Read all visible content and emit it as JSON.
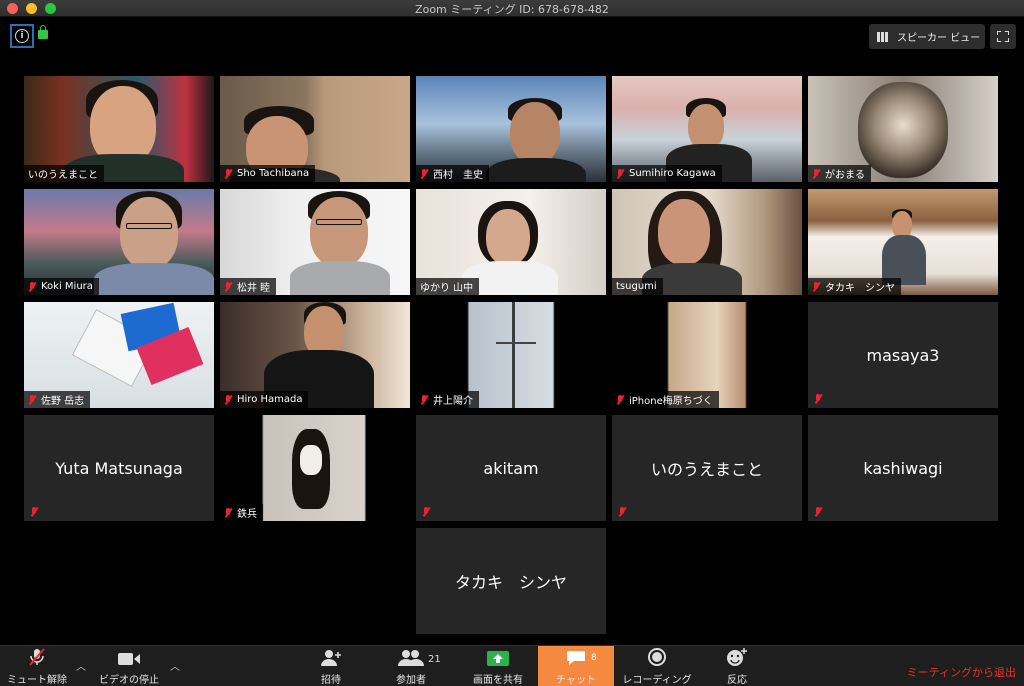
{
  "window": {
    "title": "Zoom ミーティング ID: 678-678-482"
  },
  "topbar": {
    "view_label": "スピーカー ビュー",
    "info_glyph": "i"
  },
  "tiles": [
    {
      "name": "いのうえまこと",
      "video": true,
      "active": true,
      "muted": false
    },
    {
      "name": "Sho Tachibana",
      "video": true,
      "muted": true
    },
    {
      "name": "西村　圭史",
      "video": true,
      "muted": true
    },
    {
      "name": "Sumihiro Kagawa",
      "video": true,
      "muted": true
    },
    {
      "name": "がおまる",
      "video": true,
      "muted": true
    },
    {
      "name": "Koki Miura",
      "video": true,
      "muted": true
    },
    {
      "name": "松井 睦",
      "video": true,
      "muted": true
    },
    {
      "name": "ゆかり 山中",
      "video": true,
      "muted": false
    },
    {
      "name": "tsugumi",
      "video": true,
      "muted": false
    },
    {
      "name": "タカキ　シンヤ",
      "video": true,
      "muted": true
    },
    {
      "name": "佐野 岳志",
      "video": true,
      "muted": true
    },
    {
      "name": "Hiro Hamada",
      "video": true,
      "muted": true
    },
    {
      "name": "井上陽介",
      "video": true,
      "muted": true
    },
    {
      "name": "iPhone梅原ちづく",
      "video": true,
      "muted": true
    },
    {
      "name": "masaya3",
      "video": false,
      "muted": true
    },
    {
      "name": "Yuta Matsunaga",
      "video": false,
      "muted": true
    },
    {
      "name": "鉄兵",
      "video": true,
      "muted": true
    },
    {
      "name": "akitam",
      "video": false,
      "muted": true
    },
    {
      "name": "いのうえまこと",
      "video": false,
      "muted": true
    },
    {
      "name": "kashiwagi",
      "video": false,
      "muted": true
    },
    {
      "name": "タカキ　シンヤ",
      "video": false,
      "muted": false
    }
  ],
  "toolbar": {
    "mute_label": "ミュート解除",
    "video_label": "ビデオの停止",
    "invite_label": "招待",
    "participants_label": "参加者",
    "participants_count": "21",
    "share_label": "画面を共有",
    "chat_label": "チャット",
    "chat_count": "8",
    "record_label": "レコーディング",
    "reactions_label": "反応",
    "leave_label": "ミーティングから退出"
  },
  "colors": {
    "active_outline": "#d6e072",
    "chat_bg": "#f5893f",
    "leave": "#e8332d",
    "share_icon": "#2db34a"
  }
}
